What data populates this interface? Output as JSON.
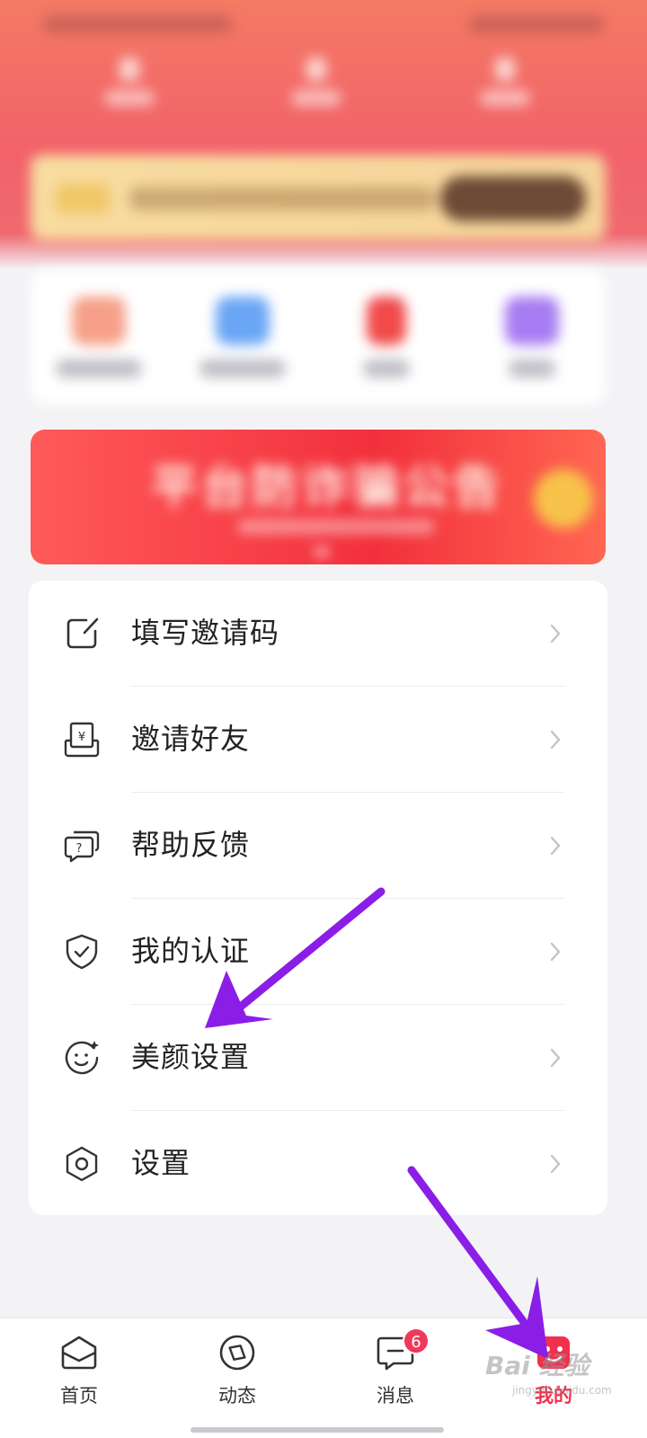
{
  "menu": {
    "items": [
      {
        "label": "填写邀请码",
        "icon": "edit-icon"
      },
      {
        "label": "邀请好友",
        "icon": "invite-gift-icon"
      },
      {
        "label": "帮助反馈",
        "icon": "help-chat-icon"
      },
      {
        "label": "我的认证",
        "icon": "shield-check-icon"
      },
      {
        "label": "美颜设置",
        "icon": "beauty-face-icon"
      },
      {
        "label": "设置",
        "icon": "gear-icon"
      }
    ]
  },
  "promo": {
    "title": "平台防诈骗公告"
  },
  "bottom_nav": {
    "items": [
      {
        "label": "首页",
        "icon": "home-icon"
      },
      {
        "label": "动态",
        "icon": "compass-icon"
      },
      {
        "label": "消息",
        "icon": "message-icon",
        "badge": "6"
      },
      {
        "label": "我的",
        "icon": "profile-icon",
        "active": true
      }
    ]
  },
  "watermark": {
    "text": "Bai 经验",
    "sub": "jingyan.baidu.com"
  },
  "colors": {
    "accent": "#f0304c",
    "annotation_arrow": "#8a1ee6",
    "header_gradient_top": "#f47a64",
    "header_gradient_bottom": "#f2626a"
  }
}
